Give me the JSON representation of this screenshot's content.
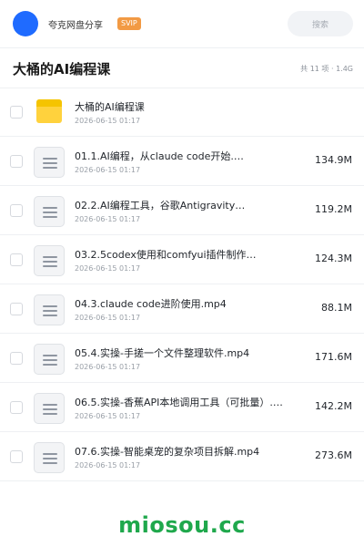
{
  "header": {
    "brand": "夸克网盘分享",
    "badge": "SVIP",
    "search_label": "搜索"
  },
  "titlebar": {
    "title": "大桶的AI编程课",
    "meta": "共 11 项 · 1.4G"
  },
  "files": [
    {
      "name": "大桶的AI编程课",
      "date": "2026-06-15 01:17",
      "size": "",
      "icon": "folder-icon"
    },
    {
      "name": "01.1.AI编程，从claude code开始.…",
      "date": "2026-06-15 01:17",
      "size": "134.9M",
      "icon": "file-icon"
    },
    {
      "name": "02.2.AI编程工具，谷歌Antigravity…",
      "date": "2026-06-15 01:17",
      "size": "119.2M",
      "icon": "file-icon"
    },
    {
      "name": "03.2.5codex使用和comfyui插件制作…",
      "date": "2026-06-15 01:17",
      "size": "124.3M",
      "icon": "file-icon"
    },
    {
      "name": "04.3.claude code进阶使用.mp4",
      "date": "2026-06-15 01:17",
      "size": "88.1M",
      "icon": "file-icon"
    },
    {
      "name": "05.4.实操-手搓一个文件整理软件.mp4",
      "date": "2026-06-15 01:17",
      "size": "171.6M",
      "icon": "file-icon"
    },
    {
      "name": "06.5.实操-香蕉API本地调用工具（可批量）.…",
      "date": "2026-06-15 01:17",
      "size": "142.2M",
      "icon": "file-icon"
    },
    {
      "name": "07.6.实操-智能桌宠的复杂项目拆解.mp4",
      "date": "2026-06-15 01:17",
      "size": "273.6M",
      "icon": "file-icon"
    }
  ],
  "watermark": "miosou.cc",
  "colors": {
    "accent": "#1f6bff",
    "svip": "#f29a44",
    "folder": "#ffd23d",
    "watermark": "#1fa84c"
  }
}
